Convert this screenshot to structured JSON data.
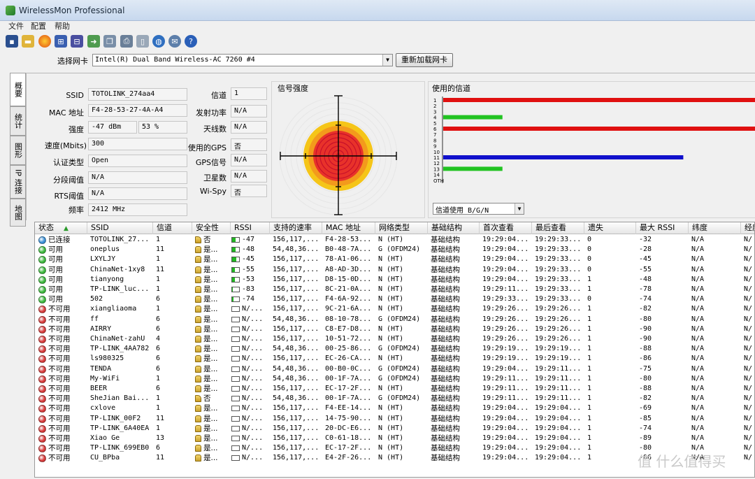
{
  "app": {
    "title": "WirelessMon Professional"
  },
  "menu": {
    "items": [
      "文件",
      "配置",
      "帮助"
    ]
  },
  "toolbar": {
    "icons": [
      "save-icon",
      "open-folder-icon",
      "record-icon",
      "network-icon",
      "network-alt-icon",
      "export-icon",
      "copy-icon",
      "print-icon",
      "clipboard-icon",
      "globe-icon",
      "comment-icon",
      "help-icon"
    ]
  },
  "adapter": {
    "label": "选择网卡",
    "selected": "Intel(R) Dual Band Wireless-AC 7260 #4",
    "reload_label": "重新加载网卡"
  },
  "tabs": [
    "概要",
    "统计",
    "图形",
    "IP 连接",
    "地图"
  ],
  "summary": {
    "ssid_label": "SSID",
    "ssid": "TOTOLINK_274aa4",
    "mac_label": "MAC 地址",
    "mac": "F4-28-53-27-4A-A4",
    "strength_label": "强度",
    "strength_dbm": "-47 dBm",
    "strength_pct": "53 %",
    "speed_label": "速度(Mbits)",
    "speed": "300",
    "auth_label": "认证类型",
    "auth": "Open",
    "frag_label": "分段阈值",
    "frag": "N/A",
    "rts_label": "RTS阈值",
    "rts": "N/A",
    "freq_label": "频率",
    "freq": "2412 MHz",
    "channel_label": "信道",
    "channel": "1",
    "txpower_label": "发射功率",
    "txpower": "N/A",
    "antenna_label": "天线数",
    "antenna": "N/A",
    "usegps_label": "使用的GPS",
    "usegps": "否",
    "gpssignal_label": "GPS信号",
    "gpssignal": "N/A",
    "satellites_label": "卫星数",
    "satellites": "N/A",
    "wispy_label": "Wi-Spy",
    "wispy": "否"
  },
  "signal": {
    "title": "信号强度"
  },
  "channels": {
    "title": "使用的信道",
    "labels": [
      "1",
      "2",
      "3",
      "4",
      "5",
      "6",
      "7",
      "8",
      "9",
      "10",
      "11",
      "12",
      "13",
      "14",
      "OTH"
    ],
    "bars": [
      {
        "channel": "1",
        "level": 1.0,
        "color": "#e01010"
      },
      {
        "channel": "4",
        "level": 0.19,
        "color": "#22c322"
      },
      {
        "channel": "6",
        "level": 1.0,
        "color": "#e01010"
      },
      {
        "channel": "11",
        "level": 0.77,
        "color": "#1010cc"
      },
      {
        "channel": "13",
        "level": 0.19,
        "color": "#22c322"
      }
    ],
    "mode_select": "信道使用 B/G/N"
  },
  "table": {
    "columns": [
      "状态",
      "SSID",
      "信道",
      "安全性",
      "RSSI",
      "支持的速率",
      "MAC 地址",
      "网络类型",
      "基础结构",
      "首次查看",
      "最后查看",
      "遗失",
      "最大 RSSI",
      "纬度",
      "经度"
    ],
    "sort_indicator": "▲",
    "rows": [
      {
        "status": "已连接",
        "color": "#3a8fd6",
        "ssid": "TOTOLINK_27...",
        "ch": "1",
        "sec": "否",
        "lock": "open",
        "rssi": "-47",
        "rssi_fill": 0.53,
        "rates": "156,117,...",
        "mac": "F4-28-53...",
        "type": "N (HT)",
        "infra": "基础结构",
        "first": "19:29:04...",
        "last": "19:29:33...",
        "lost": "0",
        "max": "-32",
        "lat": "N/A",
        "lon": "N/"
      },
      {
        "status": "可用",
        "color": "#3cb83c",
        "ssid": "oneplus",
        "ch": "11",
        "sec": "是...",
        "lock": "closed",
        "rssi": "-48",
        "rssi_fill": 0.5,
        "rates": "54,48,36...",
        "mac": "B0-48-7A...",
        "type": "G (OFDM24)",
        "infra": "基础结构",
        "first": "19:29:04...",
        "last": "19:29:33...",
        "lost": "0",
        "max": "-28",
        "lat": "N/A",
        "lon": "N/"
      },
      {
        "status": "可用",
        "color": "#3cb83c",
        "ssid": "LXYLJY",
        "ch": "1",
        "sec": "是...",
        "lock": "closed",
        "rssi": "-45",
        "rssi_fill": 0.55,
        "rates": "156,117,...",
        "mac": "78-A1-06...",
        "type": "N (HT)",
        "infra": "基础结构",
        "first": "19:29:04...",
        "last": "19:29:33...",
        "lost": "0",
        "max": "-45",
        "lat": "N/A",
        "lon": "N/"
      },
      {
        "status": "可用",
        "color": "#3cb83c",
        "ssid": "ChinaNet-1xy8",
        "ch": "11",
        "sec": "是...",
        "lock": "closed",
        "rssi": "-55",
        "rssi_fill": 0.4,
        "rates": "156,117,...",
        "mac": "A8-AD-3D...",
        "type": "N (HT)",
        "infra": "基础结构",
        "first": "19:29:04...",
        "last": "19:29:33...",
        "lost": "0",
        "max": "-55",
        "lat": "N/A",
        "lon": "N/"
      },
      {
        "status": "可用",
        "color": "#3cb83c",
        "ssid": "tianyong",
        "ch": "1",
        "sec": "是...",
        "lock": "closed",
        "rssi": "-53",
        "rssi_fill": 0.42,
        "rates": "156,117,...",
        "mac": "D8-15-0D...",
        "type": "N (HT)",
        "infra": "基础结构",
        "first": "19:29:04...",
        "last": "19:29:33...",
        "lost": "1",
        "max": "-48",
        "lat": "N/A",
        "lon": "N/"
      },
      {
        "status": "可用",
        "color": "#3cb83c",
        "ssid": "TP-LINK_luc...",
        "ch": "1",
        "sec": "是...",
        "lock": "closed",
        "rssi": "-83",
        "rssi_fill": 0.08,
        "rates": "156,117,...",
        "mac": "8C-21-0A...",
        "type": "N (HT)",
        "infra": "基础结构",
        "first": "19:29:11...",
        "last": "19:29:33...",
        "lost": "1",
        "max": "-78",
        "lat": "N/A",
        "lon": "N/"
      },
      {
        "status": "可用",
        "color": "#3cb83c",
        "ssid": "502",
        "ch": "6",
        "sec": "是...",
        "lock": "closed",
        "rssi": "-74",
        "rssi_fill": 0.2,
        "rates": "156,117,...",
        "mac": "F4-6A-92...",
        "type": "N (HT)",
        "infra": "基础结构",
        "first": "19:29:33...",
        "last": "19:29:33...",
        "lost": "0",
        "max": "-74",
        "lat": "N/A",
        "lon": "N/"
      },
      {
        "status": "不可用",
        "color": "#d83a3a",
        "ssid": "xiangliaoma",
        "ch": "1",
        "sec": "是...",
        "lock": "closed",
        "rssi": "N/...",
        "rssi_fill": 0,
        "rates": "156,117,...",
        "mac": "9C-21-6A...",
        "type": "N (HT)",
        "infra": "基础结构",
        "first": "19:29:26...",
        "last": "19:29:26...",
        "lost": "1",
        "max": "-82",
        "lat": "N/A",
        "lon": "N/"
      },
      {
        "status": "不可用",
        "color": "#d83a3a",
        "ssid": "ff",
        "ch": "6",
        "sec": "是...",
        "lock": "closed",
        "rssi": "N/...",
        "rssi_fill": 0,
        "rates": "54,48,36...",
        "mac": "08-10-78...",
        "type": "G (OFDM24)",
        "infra": "基础结构",
        "first": "19:29:26...",
        "last": "19:29:26...",
        "lost": "1",
        "max": "-80",
        "lat": "N/A",
        "lon": "N/"
      },
      {
        "status": "不可用",
        "color": "#d83a3a",
        "ssid": "AIRRY",
        "ch": "6",
        "sec": "是...",
        "lock": "closed",
        "rssi": "N/...",
        "rssi_fill": 0,
        "rates": "156,117,...",
        "mac": "C8-E7-D8...",
        "type": "N (HT)",
        "infra": "基础结构",
        "first": "19:29:26...",
        "last": "19:29:26...",
        "lost": "1",
        "max": "-90",
        "lat": "N/A",
        "lon": "N/"
      },
      {
        "status": "不可用",
        "color": "#d83a3a",
        "ssid": "ChinaNet-zahU",
        "ch": "4",
        "sec": "是...",
        "lock": "closed",
        "rssi": "N/...",
        "rssi_fill": 0,
        "rates": "156,117,...",
        "mac": "10-51-72...",
        "type": "N (HT)",
        "infra": "基础结构",
        "first": "19:29:26...",
        "last": "19:29:26...",
        "lost": "1",
        "max": "-90",
        "lat": "N/A",
        "lon": "N/"
      },
      {
        "status": "不可用",
        "color": "#d83a3a",
        "ssid": "TP-LINK_4AA782",
        "ch": "6",
        "sec": "是...",
        "lock": "closed",
        "rssi": "N/...",
        "rssi_fill": 0,
        "rates": "54,48,36...",
        "mac": "00-25-86...",
        "type": "G (OFDM24)",
        "infra": "基础结构",
        "first": "19:29:19...",
        "last": "19:29:19...",
        "lost": "1",
        "max": "-88",
        "lat": "N/A",
        "lon": "N/"
      },
      {
        "status": "不可用",
        "color": "#d83a3a",
        "ssid": "ls980325",
        "ch": "6",
        "sec": "是...",
        "lock": "closed",
        "rssi": "N/...",
        "rssi_fill": 0,
        "rates": "156,117,...",
        "mac": "EC-26-CA...",
        "type": "N (HT)",
        "infra": "基础结构",
        "first": "19:29:19...",
        "last": "19:29:19...",
        "lost": "1",
        "max": "-86",
        "lat": "N/A",
        "lon": "N/"
      },
      {
        "status": "不可用",
        "color": "#d83a3a",
        "ssid": "TENDA",
        "ch": "6",
        "sec": "是...",
        "lock": "closed",
        "rssi": "N/...",
        "rssi_fill": 0,
        "rates": "54,48,36...",
        "mac": "00-B0-0C...",
        "type": "G (OFDM24)",
        "infra": "基础结构",
        "first": "19:29:04...",
        "last": "19:29:11...",
        "lost": "1",
        "max": "-75",
        "lat": "N/A",
        "lon": "N/"
      },
      {
        "status": "不可用",
        "color": "#d83a3a",
        "ssid": "My-WiFi",
        "ch": "1",
        "sec": "是...",
        "lock": "closed",
        "rssi": "N/...",
        "rssi_fill": 0,
        "rates": "54,48,36...",
        "mac": "00-1F-7A...",
        "type": "G (OFDM24)",
        "infra": "基础结构",
        "first": "19:29:11...",
        "last": "19:29:11...",
        "lost": "1",
        "max": "-80",
        "lat": "N/A",
        "lon": "N/"
      },
      {
        "status": "不可用",
        "color": "#d83a3a",
        "ssid": "BEER",
        "ch": "6",
        "sec": "是...",
        "lock": "closed",
        "rssi": "N/...",
        "rssi_fill": 0,
        "rates": "156,117,...",
        "mac": "EC-17-2F...",
        "type": "N (HT)",
        "infra": "基础结构",
        "first": "19:29:11...",
        "last": "19:29:11...",
        "lost": "1",
        "max": "-88",
        "lat": "N/A",
        "lon": "N/"
      },
      {
        "status": "不可用",
        "color": "#d83a3a",
        "ssid": "SheJian Bai...",
        "ch": "1",
        "sec": "否",
        "lock": "open",
        "rssi": "N/...",
        "rssi_fill": 0,
        "rates": "54,48,36...",
        "mac": "00-1F-7A...",
        "type": "G (OFDM24)",
        "infra": "基础结构",
        "first": "19:29:11...",
        "last": "19:29:11...",
        "lost": "1",
        "max": "-82",
        "lat": "N/A",
        "lon": "N/"
      },
      {
        "status": "不可用",
        "color": "#d83a3a",
        "ssid": "cxlove",
        "ch": "1",
        "sec": "是...",
        "lock": "closed",
        "rssi": "N/...",
        "rssi_fill": 0,
        "rates": "156,117,...",
        "mac": "F4-EE-14...",
        "type": "N (HT)",
        "infra": "基础结构",
        "first": "19:29:04...",
        "last": "19:29:04...",
        "lost": "1",
        "max": "-69",
        "lat": "N/A",
        "lon": "N/"
      },
      {
        "status": "不可用",
        "color": "#d83a3a",
        "ssid": "TP-LINK_00F2",
        "ch": "11",
        "sec": "是...",
        "lock": "closed",
        "rssi": "N/...",
        "rssi_fill": 0,
        "rates": "156,117,...",
        "mac": "14-75-90...",
        "type": "N (HT)",
        "infra": "基础结构",
        "first": "19:29:04...",
        "last": "19:29:04...",
        "lost": "1",
        "max": "-85",
        "lat": "N/A",
        "lon": "N/"
      },
      {
        "status": "不可用",
        "color": "#d83a3a",
        "ssid": "TP-LINK_6A40EA",
        "ch": "1",
        "sec": "是...",
        "lock": "closed",
        "rssi": "N/...",
        "rssi_fill": 0,
        "rates": "156,117,...",
        "mac": "20-DC-E6...",
        "type": "N (HT)",
        "infra": "基础结构",
        "first": "19:29:04...",
        "last": "19:29:04...",
        "lost": "1",
        "max": "-74",
        "lat": "N/A",
        "lon": "N/"
      },
      {
        "status": "不可用",
        "color": "#d83a3a",
        "ssid": "Xiao Ge",
        "ch": "13",
        "sec": "是...",
        "lock": "closed",
        "rssi": "N/...",
        "rssi_fill": 0,
        "rates": "156,117,...",
        "mac": "C0-61-18...",
        "type": "N (HT)",
        "infra": "基础结构",
        "first": "19:29:04...",
        "last": "19:29:04...",
        "lost": "1",
        "max": "-89",
        "lat": "N/A",
        "lon": "N/"
      },
      {
        "status": "不可用",
        "color": "#d83a3a",
        "ssid": "TP-LINK_699EB0",
        "ch": "6",
        "sec": "是...",
        "lock": "closed",
        "rssi": "N/...",
        "rssi_fill": 0,
        "rates": "156,117,...",
        "mac": "EC-17-2F...",
        "type": "N (HT)",
        "infra": "基础结构",
        "first": "19:29:04...",
        "last": "19:29:04...",
        "lost": "1",
        "max": "-80",
        "lat": "N/A",
        "lon": "N/"
      },
      {
        "status": "不可用",
        "color": "#d83a3a",
        "ssid": "CU_BPba",
        "ch": "11",
        "sec": "是...",
        "lock": "closed",
        "rssi": "N/...",
        "rssi_fill": 0,
        "rates": "156,117,...",
        "mac": "E4-2F-26...",
        "type": "N (HT)",
        "infra": "基础结构",
        "first": "19:29:04...",
        "last": "19:29:04...",
        "lost": "1",
        "max": "-86",
        "lat": "N/A",
        "lon": "N/"
      }
    ]
  },
  "watermark": "值 什么值得买"
}
